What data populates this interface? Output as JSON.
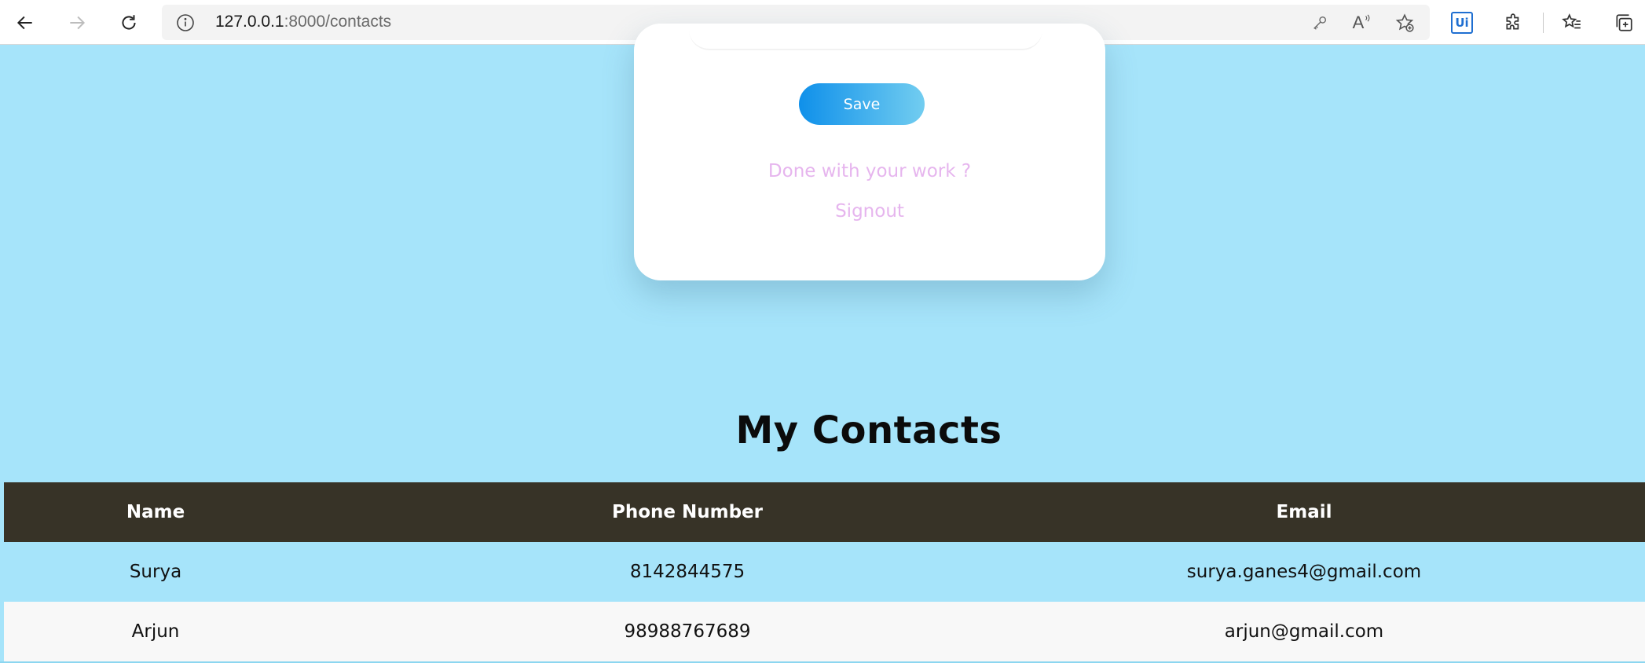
{
  "browser": {
    "url_host": "127.0.0.1",
    "url_path": ":8000/contacts",
    "icons": [
      "back-arrow-icon",
      "forward-arrow-icon",
      "refresh-icon",
      "site-info-icon",
      "key-icon",
      "read-aloud-icon",
      "add-favorite-icon",
      "ui-extension-icon",
      "extensions-icon",
      "favorites-icon",
      "collections-icon"
    ],
    "read_aloud_glyph": "A",
    "ui_extension_label": "Ui"
  },
  "card": {
    "save_label": "Save",
    "done_text": "Done with your work ?",
    "signout_label": "Signout"
  },
  "contacts": {
    "title": "My Contacts",
    "columns": [
      "Name",
      "Phone Number",
      "Email"
    ],
    "rows": [
      {
        "name": "Surya",
        "phone": "8142844575",
        "email": "surya.ganes4@gmail.com"
      },
      {
        "name": "Arjun",
        "phone": "98988767689",
        "email": "arjun@gmail.com"
      }
    ]
  },
  "colors": {
    "page_background": "#a6e4fa",
    "table_header": "#373327",
    "save_gradient_start": "#0f90ea",
    "save_gradient_end": "#72cdf0",
    "link_color": "#e6b5ee"
  }
}
